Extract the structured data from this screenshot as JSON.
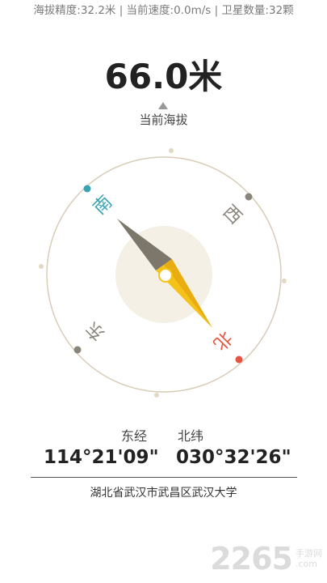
{
  "status_bar": {
    "text": "海拔精度:32.2米 | 当前速度:0.0m/s | 卫星数量:32颗"
  },
  "altitude": {
    "value": "66.0米",
    "label": "当前海拔"
  },
  "compass": {
    "directions": {
      "south": "南",
      "west": "西",
      "east": "东",
      "north": "北"
    },
    "colors": {
      "needle_north": "#f5c21a",
      "needle_south": "#7c766b",
      "north_marker": "#e8533f",
      "south_marker": "#3aa3b4",
      "ring": "#d8ccb6",
      "center_disc": "#f4f0e6"
    }
  },
  "coordinates": {
    "longitude_label": "东经",
    "latitude_label": "北纬",
    "longitude": "114°21'09\"",
    "latitude": "030°32'26\""
  },
  "address": "湖北省武汉市武昌区武汉大学",
  "watermark": {
    "number": "2265",
    "suffix": ".com",
    "site": "手游网"
  }
}
